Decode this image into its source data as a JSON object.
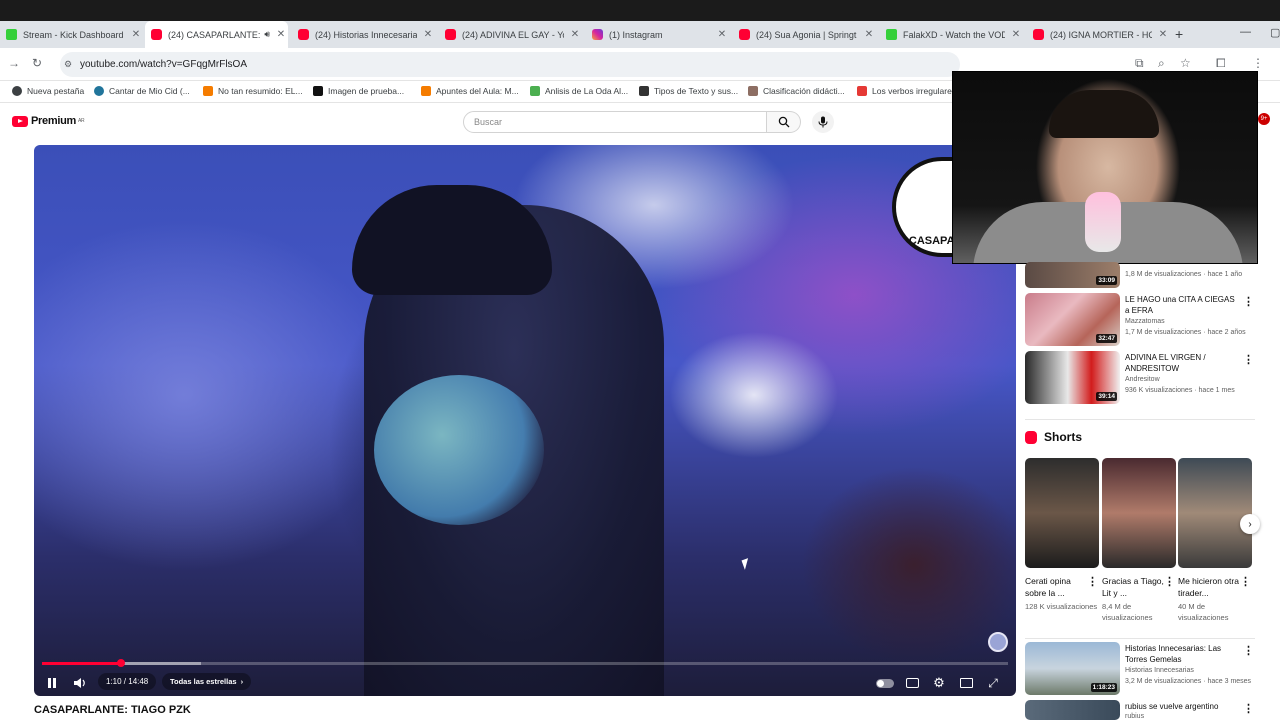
{
  "tabs": [
    {
      "title": "Stream - Kick Dashboard",
      "icon": "kick-icon"
    },
    {
      "title": "(24) CASAPARLANTE:",
      "icon": "youtube-icon",
      "active": true
    },
    {
      "title": "(24) Historias Innecesarias",
      "icon": "youtube-icon"
    },
    {
      "title": "(24) ADIVINA EL GAY - Yo",
      "icon": "youtube-icon"
    },
    {
      "title": "(1) Instagram",
      "icon": "instagram-icon"
    },
    {
      "title": "(24) Sua Agonia | Springt",
      "icon": "youtube-icon"
    },
    {
      "title": "FalakXD - Watch the VOD",
      "icon": "kick-icon"
    },
    {
      "title": "(24) IGNA MORTIER - HC",
      "icon": "youtube-icon"
    }
  ],
  "address": {
    "url": "youtube.com/watch?v=GFqgMrFlsOA"
  },
  "bookmarks": [
    "Nueva pestaña",
    "Cantar de Mio Cid (...",
    "No tan resumido: EL...",
    "Imagen de prueba...",
    "Apuntes del Aula: M...",
    "Anlisis de La Oda Al...",
    "Tipos de Texto y sus...",
    "Clasificación didácti...",
    "Los verbos irregulares"
  ],
  "youtube": {
    "logo_text": "Premium",
    "region": "AR",
    "search_placeholder": "Buscar"
  },
  "player": {
    "channel_watermark": "CASAPARLANTE",
    "time": "1:10 / 14:48",
    "chapter": "Todas las estrellas",
    "progress_fraction": 0.082,
    "buffer_fraction": 0.165
  },
  "video_title": "CASAPARLANTE: TIAGO PZK",
  "recommendations": [
    {
      "title": "",
      "channel": "",
      "meta": "1,8 M de visualizaciones · hace 1 año",
      "duration": "33:09"
    },
    {
      "title": "LE HAGO una CITA A CIEGAS a EFRA",
      "channel": "Mazzatomas",
      "meta": "1,7 M de visualizaciones · hace 2 años",
      "duration": "32:47"
    },
    {
      "title": "ADIVINA EL VIRGEN / ANDRESITOW",
      "channel": "Andresitow",
      "meta": "936 K visualizaciones · hace 1 mes",
      "duration": "39:14"
    }
  ],
  "shorts": {
    "heading": "Shorts",
    "items": [
      {
        "title": "Cerati opina sobre la ...",
        "views": "128 K visualizaciones"
      },
      {
        "title": "Gracias a Tiago, Lit y ...",
        "views": "8,4 M de visualizaciones"
      },
      {
        "title": "Me hicieron otra tirader...",
        "views": "40 M de visualizaciones"
      }
    ]
  },
  "more_recs": [
    {
      "title": "Historias Innecesarias: Las Torres Gemelas",
      "channel": "Historias Innecesarias",
      "meta": "3,2 M de visualizaciones · hace 3 meses",
      "duration": "1:18:23"
    },
    {
      "title": "rubius se vuelve argentino",
      "channel": "rubius",
      "meta": "",
      "duration": ""
    }
  ],
  "colors": {
    "brand_red": "#ff0033",
    "tab_bar": "#dfe3e8"
  }
}
